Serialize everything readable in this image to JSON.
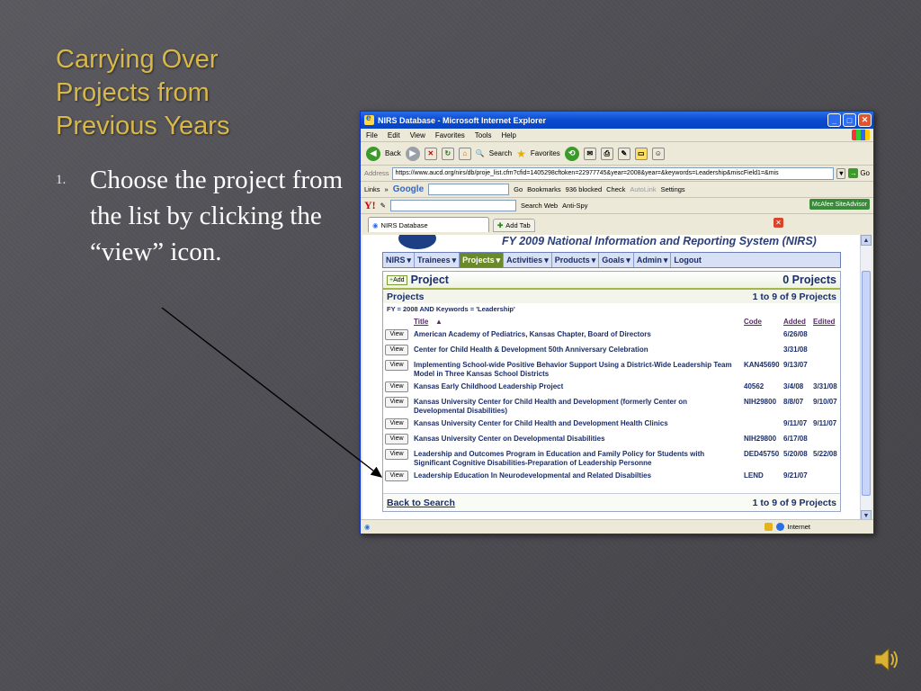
{
  "slide": {
    "title": "Carrying Over Projects from Previous Years",
    "bullet_number": "1.",
    "bullet_text": "Choose the project from the list by clicking the “view” icon."
  },
  "browser": {
    "window_title": "NIRS Database - Microsoft Internet Explorer",
    "menu": [
      "File",
      "Edit",
      "View",
      "Favorites",
      "Tools",
      "Help"
    ],
    "toolbar": {
      "back": "Back",
      "search": "Search",
      "favorites": "Favorites"
    },
    "address_label": "Address",
    "address_url": "https://www.aucd.org/nirs/db/proje_list.cfm?cfid=1405298cftoken=22977745&year=2008&year=&keywords=Leadership&miscField1=&mis",
    "go_label": "Go",
    "links_label": "Links",
    "google_label": "Google",
    "google_go": "Go",
    "bookmarks_label": "Bookmarks",
    "blocked_label": "936 blocked",
    "check_label": "Check",
    "autolink_label": "AutoLink",
    "settings_label": "Settings",
    "yahoo_label": "Y!",
    "search_web_label": "Search Web",
    "antispy_label": "Anti-Spy",
    "tab_label": "NIRS Database",
    "add_tab_label": "Add Tab",
    "mcafee_label": "McAfee SiteAdvisor",
    "status_zone": "Internet"
  },
  "site": {
    "title": "FY 2009 National Information and Reporting System (NIRS)",
    "nav": [
      "NIRS",
      "Trainees",
      "Projects",
      "Activities",
      "Products",
      "Goals",
      "Admin",
      "Logout"
    ],
    "active_nav": "Projects"
  },
  "panel": {
    "add_label": "Add",
    "title": "Project",
    "count": "0 Projects",
    "sub_title": "Projects",
    "range": "1 to 9 of 9 Projects",
    "filter": "FY = 2008 AND Keywords = 'Leadership'",
    "col_title": "Title",
    "col_code": "Code",
    "col_added": "Added",
    "col_edited": "Edited",
    "view_label": "View",
    "rows": [
      {
        "title": "American Academy of Pediatrics, Kansas Chapter, Board of Directors",
        "code": "",
        "added": "6/26/08",
        "edited": ""
      },
      {
        "title": "Center for Child Health & Development 50th Anniversary Celebration",
        "code": "",
        "added": "3/31/08",
        "edited": ""
      },
      {
        "title": "Implementing School-wide Positive Behavior Support Using a District-Wide Leadership Team Model in Three Kansas School Districts",
        "code": "KAN45690",
        "added": "9/13/07",
        "edited": ""
      },
      {
        "title": "Kansas Early Childhood Leadership Project",
        "code": "40562",
        "added": "3/4/08",
        "edited": "3/31/08"
      },
      {
        "title": "Kansas University Center for Child Health and Development (formerly Center on Developmental Disabilities)",
        "code": "NIH29800",
        "added": "8/8/07",
        "edited": "9/10/07"
      },
      {
        "title": "Kansas University Center for Child Health and Development Health Clinics",
        "code": "",
        "added": "9/11/07",
        "edited": "9/11/07"
      },
      {
        "title": "Kansas University Center on Developmental Disabilities",
        "code": "NIH29800",
        "added": "6/17/08",
        "edited": ""
      },
      {
        "title": "Leadership and Outcomes Program in Education and Family Policy for Students with Significant Cognitive Disabilities-Preparation of Leadership Personne",
        "code": "DED45750",
        "added": "5/20/08",
        "edited": "5/22/08"
      },
      {
        "title": "Leadership Education In Neurodevelopmental and Related Disabilties",
        "code": "LEND",
        "added": "9/21/07",
        "edited": ""
      }
    ],
    "back_label": "Back to Search",
    "footer_range": "1 to 9 of 9 Projects"
  }
}
